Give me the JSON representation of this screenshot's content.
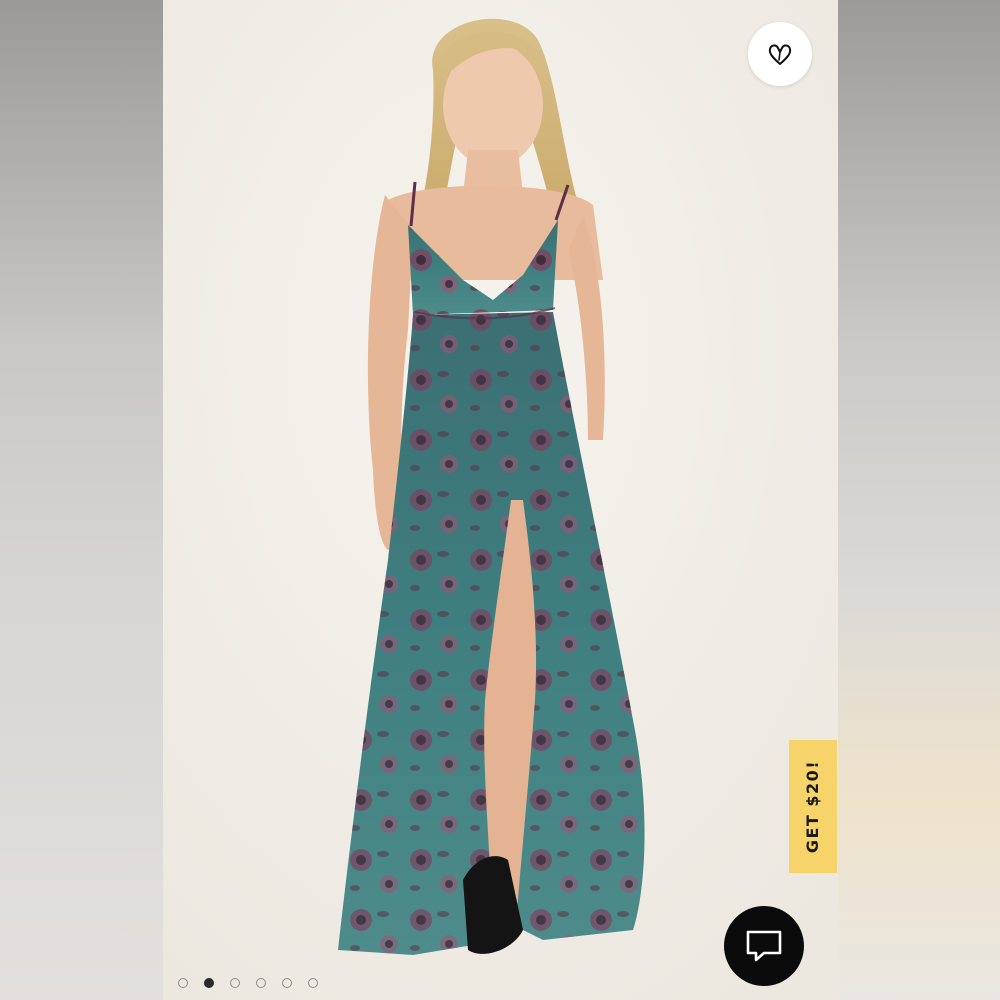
{
  "product_image": {
    "alt": "",
    "slide_count": 6,
    "active_slide": 2
  },
  "wishlist": {
    "icon": "heart-icon"
  },
  "promo": {
    "label": "GET $20!",
    "color": "#f6d46a"
  },
  "chat": {
    "icon": "chat-bubble-icon"
  },
  "colors": {
    "dress_teal": "#3f7d7f",
    "dress_rose": "#8e4a6b",
    "backdrop": "#f3efe8"
  }
}
